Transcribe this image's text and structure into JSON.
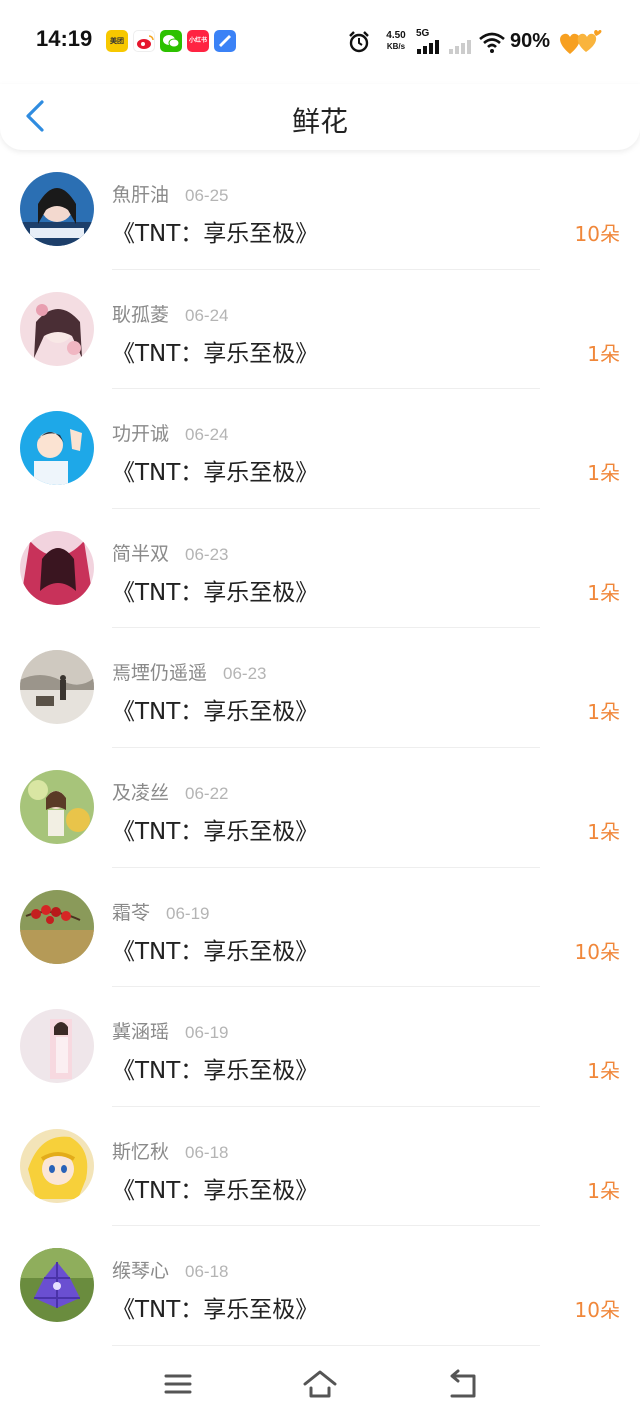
{
  "status": {
    "time": "14:19",
    "net_speed_value": "4.50",
    "net_speed_unit": "KB/s",
    "network_type": "5G",
    "battery": "90%",
    "app_icons": [
      {
        "name": "meituan-icon",
        "label": "美团",
        "color": "#f7c800"
      },
      {
        "name": "weibo-icon",
        "label": "",
        "color": "#ffffff"
      },
      {
        "name": "wechat-icon",
        "label": "",
        "color": "#2dc100"
      },
      {
        "name": "xiaohongshu-icon",
        "label": "小红书",
        "color": "#ff2442"
      },
      {
        "name": "app-icon-blue",
        "label": "",
        "color": "#3b82f6"
      }
    ]
  },
  "nav": {
    "title": "鲜花"
  },
  "colors": {
    "accent_blue": "#2f8ce0",
    "count_orange": "#f0873a"
  },
  "items": [
    {
      "name": "魚肝油",
      "date": "06-25",
      "title": "《TNT：享乐至极》",
      "count": "10朵"
    },
    {
      "name": "耿孤菱",
      "date": "06-24",
      "title": "《TNT：享乐至极》",
      "count": "1朵"
    },
    {
      "name": "功开诚",
      "date": "06-24",
      "title": "《TNT：享乐至极》",
      "count": "1朵"
    },
    {
      "name": "简半双",
      "date": "06-23",
      "title": "《TNT：享乐至极》",
      "count": "1朵"
    },
    {
      "name": "焉堙仍遥遥",
      "date": "06-23",
      "title": "《TNT：享乐至极》",
      "count": "1朵"
    },
    {
      "name": "及凌丝",
      "date": "06-22",
      "title": "《TNT：享乐至极》",
      "count": "1朵"
    },
    {
      "name": "霜苓",
      "date": "06-19",
      "title": "《TNT：享乐至极》",
      "count": "10朵"
    },
    {
      "name": "冀涵瑶",
      "date": "06-19",
      "title": "《TNT：享乐至极》",
      "count": "1朵"
    },
    {
      "name": "斯忆秋",
      "date": "06-18",
      "title": "《TNT：享乐至极》",
      "count": "1朵"
    },
    {
      "name": "缑琴心",
      "date": "06-18",
      "title": "《TNT：享乐至极》",
      "count": "10朵"
    }
  ],
  "bottom_nav": {
    "menu_icon": "menu-icon",
    "home_icon": "home-icon",
    "back_icon": "back-icon"
  }
}
